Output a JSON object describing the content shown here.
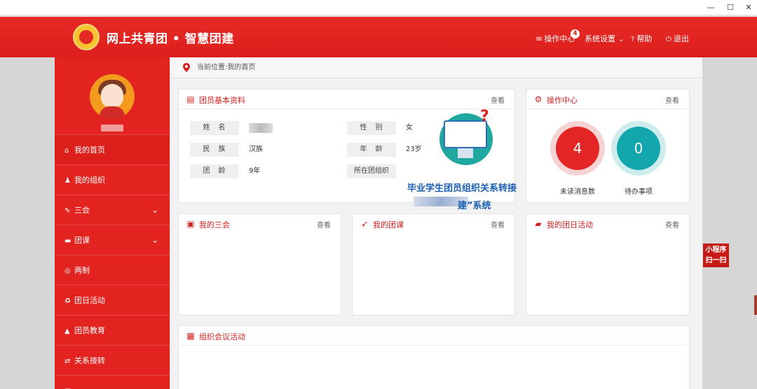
{
  "window": {
    "minimize_glyph": "—",
    "maximize_glyph": "☐",
    "close_glyph": "✕"
  },
  "header": {
    "title": "网上共青团 • 智慧团建",
    "nav": {
      "operations": "操作中心",
      "operations_badge": "4",
      "settings": "系统设置",
      "help": "帮助",
      "logout": "退出"
    }
  },
  "sidebar": {
    "items": [
      {
        "label": "我的首页",
        "icon": "home-icon",
        "glyph": "⌂"
      },
      {
        "label": "我的组织",
        "icon": "group-icon",
        "glyph": "♟"
      },
      {
        "label": "三会",
        "icon": "edit-icon",
        "glyph": "✎",
        "expandable": true
      },
      {
        "label": "团课",
        "icon": "folder-icon",
        "glyph": "▬",
        "expandable": true
      },
      {
        "label": "两制",
        "icon": "target-icon",
        "glyph": "◎"
      },
      {
        "label": "团日活动",
        "icon": "recycle-icon",
        "glyph": "♻"
      },
      {
        "label": "团员教育",
        "icon": "graduation-cap-icon",
        "glyph": "▲"
      },
      {
        "label": "关系接转",
        "icon": "transfer-icon",
        "glyph": "⇄"
      },
      {
        "label": "",
        "icon": "document-icon",
        "glyph": "■",
        "expandable": true
      }
    ]
  },
  "breadcrumb": {
    "text": "当前位置:我的首页"
  },
  "member_card": {
    "title": "团员基本资料",
    "more": "查看",
    "fields": [
      {
        "label": "姓　名",
        "value": ""
      },
      {
        "label": "民　族",
        "value": "汉族"
      },
      {
        "label": "团　龄",
        "value": "9年"
      },
      {
        "label": "性　别",
        "value": "女"
      },
      {
        "label": "年　龄",
        "value": "23岁"
      },
      {
        "label": "所在团组织",
        "value": ""
      }
    ]
  },
  "promo": {
    "title": "建”系统",
    "subtitle": "毕业学生团员组织关系转接"
  },
  "ops_card": {
    "title": "操作中心",
    "more": "查看",
    "unread_count": "4",
    "unread_label": "未读消息数",
    "todo_count": "0",
    "todo_label": "待办事项"
  },
  "cards": {
    "three_meetings": {
      "title": "我的三会",
      "more": "查看"
    },
    "league_class": {
      "title": "我的团课",
      "more": "查看"
    },
    "league_day": {
      "title": "我的团日活动",
      "more": "查看"
    },
    "org_meeting": {
      "title": "组织会议活动"
    }
  },
  "mini_program": {
    "line1": "小程序",
    "line2": "扫一扫"
  },
  "colors": {
    "brand_red": "#e2231f",
    "ring_red": "#e32525",
    "ring_teal": "#13a7ad",
    "promo_blue": "#1b5fb5"
  }
}
